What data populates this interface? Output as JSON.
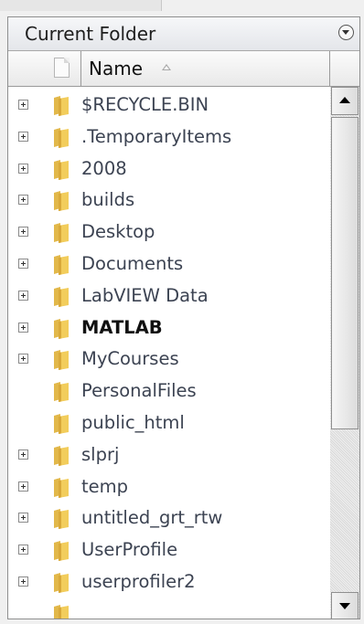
{
  "panel": {
    "title": "Current Folder"
  },
  "header": {
    "name_label": "Name"
  },
  "items": [
    {
      "label": "$RECYCLE.BIN",
      "expandable": true,
      "bold": false
    },
    {
      "label": ".TemporaryItems",
      "expandable": true,
      "bold": false
    },
    {
      "label": "2008",
      "expandable": true,
      "bold": false
    },
    {
      "label": "builds",
      "expandable": true,
      "bold": false
    },
    {
      "label": "Desktop",
      "expandable": true,
      "bold": false
    },
    {
      "label": "Documents",
      "expandable": true,
      "bold": false
    },
    {
      "label": "LabVIEW Data",
      "expandable": true,
      "bold": false
    },
    {
      "label": "MATLAB",
      "expandable": true,
      "bold": true
    },
    {
      "label": "MyCourses",
      "expandable": true,
      "bold": false
    },
    {
      "label": "PersonalFiles",
      "expandable": false,
      "bold": false
    },
    {
      "label": "public_html",
      "expandable": false,
      "bold": false
    },
    {
      "label": "slprj",
      "expandable": true,
      "bold": false
    },
    {
      "label": "temp",
      "expandable": true,
      "bold": false
    },
    {
      "label": "untitled_grt_rtw",
      "expandable": true,
      "bold": false
    },
    {
      "label": "UserProfile",
      "expandable": true,
      "bold": false
    },
    {
      "label": "userprofiler2",
      "expandable": true,
      "bold": false
    },
    {
      "label": "",
      "expandable": false,
      "bold": false
    }
  ],
  "icons": {
    "panel_menu": "circle-chevron-down-icon",
    "column_type": "document-icon",
    "sort": "sort-ascending-icon",
    "expander": "plus-box-icon",
    "folder": "folder-icon",
    "scroll_up": "arrow-up-icon",
    "scroll_down": "arrow-down-icon"
  },
  "colors": {
    "folder": "#f2cd5c",
    "text": "#3c4352"
  }
}
